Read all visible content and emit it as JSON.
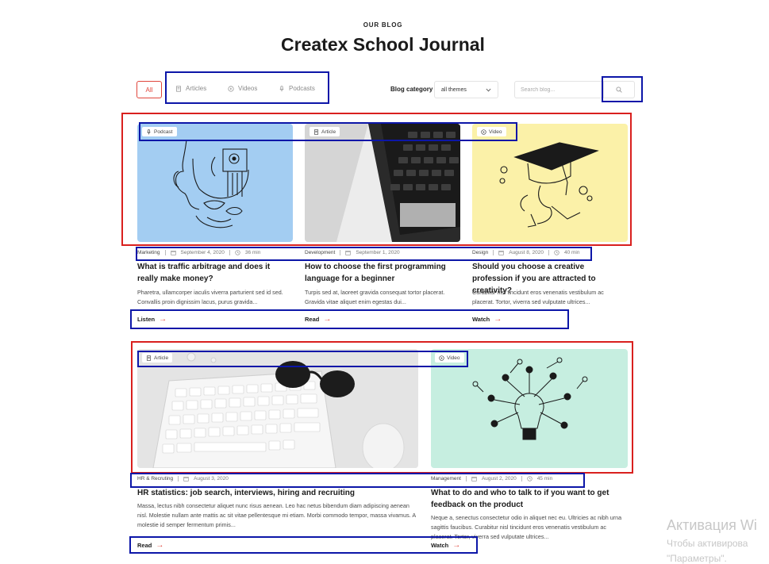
{
  "header": {
    "eyebrow": "OUR BLOG",
    "title": "Createx School Journal"
  },
  "filters": {
    "all_label": "All",
    "tabs": [
      {
        "label": "Articles",
        "icon": "article-icon"
      },
      {
        "label": "Videos",
        "icon": "video-icon"
      },
      {
        "label": "Podcasts",
        "icon": "microphone-icon"
      }
    ],
    "category_label": "Blog category",
    "category_value": "all themes",
    "search_placeholder": "Search blog..."
  },
  "posts": [
    {
      "type": "Podcast",
      "type_icon": "microphone-icon",
      "category": "Marketing",
      "date": "September 4, 2020",
      "duration": "36 min",
      "title": "What is traffic arbitrage and does it really make money?",
      "excerpt": "Pharetra, ullamcorper iaculis viverra parturient sed id sed. Convallis proin dignissim lacus, purus gravida...",
      "link": "Listen",
      "image_color": "#a3cdf2"
    },
    {
      "type": "Article",
      "type_icon": "article-icon",
      "category": "Development",
      "date": "September 1, 2020",
      "duration": "",
      "title": "How to choose the first programming language for a beginner",
      "excerpt": "Turpis sed at, laoreet gravida consequat tortor placerat. Gravida vitae aliquet enim egestas dui...",
      "link": "Read",
      "image_color": "#e9e9e9"
    },
    {
      "type": "Video",
      "type_icon": "video-icon",
      "category": "Design",
      "date": "August 8, 2020",
      "duration": "40 min",
      "title": "Should you choose a creative profession if you are attracted to creativity?",
      "excerpt": "Curabitur nisl tincidunt eros venenatis vestibulum ac placerat. Tortor, viverra sed vulputate ultrices...",
      "link": "Watch",
      "image_color": "#fbf1a8"
    },
    {
      "type": "Article",
      "type_icon": "article-icon",
      "category": "HR & Recruting",
      "date": "August 3, 2020",
      "duration": "",
      "title": "HR statistics: job search,  interviews, hiring and recruiting",
      "excerpt": "Massa, lectus nibh consectetur aliquet nunc risus aenean. Leo hac netus bibendum diam adipiscing aenean nisl. Molestie nullam ante mattis ac sit vitae pellentesque mi etiam. Morbi commodo tempor, massa vivamus. A molestie id semper fermentum primis...",
      "link": "Read",
      "image_color": "#dcdcdc"
    },
    {
      "type": "Video",
      "type_icon": "video-icon",
      "category": "Management",
      "date": "August 2, 2020",
      "duration": "45 min",
      "title": "What to do and who to talk to if you want to get feedback on the product",
      "excerpt": "Neque a, senectus consectetur odio in aliquet nec eu. Ultricies ac nibh urna sagittis faucibus. Curabitur nisl tincidunt eros venenatis vestibulum ac placerat. Tortor, viverra sed vulputate ultrices...",
      "link": "Watch",
      "image_color": "#c6eee0"
    }
  ],
  "watermark": {
    "line1": "Активация Wi",
    "line2": "Чтобы активирова",
    "line3": "\"Параметры\"."
  },
  "colors": {
    "accent": "#e0463c",
    "annotation_blue": "#0c16a8",
    "annotation_red": "#d9201e"
  }
}
